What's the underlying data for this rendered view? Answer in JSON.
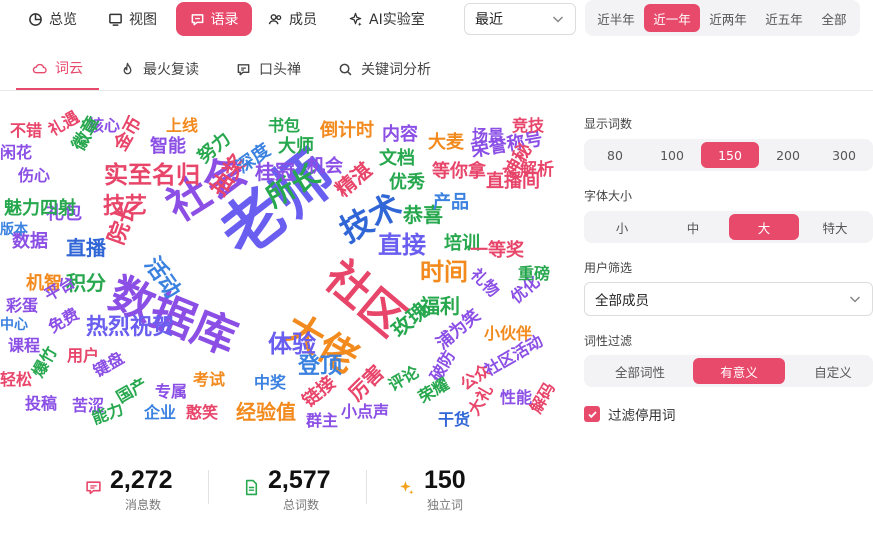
{
  "nav": {
    "items": [
      {
        "label": "总览",
        "icon": "pie-chart-icon"
      },
      {
        "label": "视图",
        "icon": "monitor-icon"
      },
      {
        "label": "语录",
        "icon": "chat-icon"
      },
      {
        "label": "成员",
        "icon": "users-icon"
      },
      {
        "label": "AI实验室",
        "icon": "sparkle-icon"
      }
    ],
    "active_index": 2
  },
  "period_select": {
    "value": "最近"
  },
  "ranges": {
    "items": [
      "近半年",
      "近一年",
      "近两年",
      "近五年",
      "全部"
    ],
    "active_index": 1
  },
  "subtabs": {
    "items": [
      {
        "label": "词云",
        "icon": "cloud-icon"
      },
      {
        "label": "最火复读",
        "icon": "fire-icon"
      },
      {
        "label": "口头禅",
        "icon": "message-icon"
      },
      {
        "label": "关键词分析",
        "icon": "search-icon"
      }
    ],
    "active_index": 0
  },
  "word_cloud": {
    "words": [
      {
        "text": "老师",
        "color": "#6a5ef0"
      },
      {
        "text": "数据库",
        "color": "#8b4fe6"
      },
      {
        "text": "社区",
        "color": "#e8456a"
      },
      {
        "text": "大佬",
        "color": "#f28a1e"
      },
      {
        "text": "社会",
        "color": "#8b4fe6"
      },
      {
        "text": "技术",
        "color": "#3166d6"
      },
      {
        "text": "所长",
        "color": "#27a84e"
      },
      {
        "text": "直接",
        "color": "#6a5ef0"
      },
      {
        "text": "时间",
        "color": "#f28a1e"
      },
      {
        "text": "活动",
        "color": "#3b82e0"
      },
      {
        "text": "实至名归",
        "color": "#e8456a"
      },
      {
        "text": "热烈祝贺",
        "color": "#6a5ef0"
      },
      {
        "text": "体验",
        "color": "#6a5ef0"
      },
      {
        "text": "登顶",
        "color": "#3b82e0"
      },
      {
        "text": "技艺",
        "color": "#e8456a"
      },
      {
        "text": "院长",
        "color": "#e8456a"
      },
      {
        "text": "抽奖",
        "color": "#e8456a"
      },
      {
        "text": "桂冠",
        "color": "#8b4fe6"
      },
      {
        "text": "精湛",
        "color": "#e8456a"
      },
      {
        "text": "恭喜",
        "color": "#27a84e"
      },
      {
        "text": "积分",
        "color": "#27a84e"
      },
      {
        "text": "直播",
        "color": "#3166d6"
      },
      {
        "text": "厉害",
        "color": "#e8456a"
      },
      {
        "text": "玫瑰",
        "color": "#27a84e"
      },
      {
        "text": "福利",
        "color": "#27a84e"
      },
      {
        "text": "经验值",
        "color": "#f28a1e"
      },
      {
        "text": "链接",
        "color": "#e8456a"
      },
      {
        "text": "机会",
        "color": "#8b4fe6"
      },
      {
        "text": "大师",
        "color": "#27a84e"
      },
      {
        "text": "文档",
        "color": "#27a84e"
      },
      {
        "text": "优秀",
        "color": "#27a84e"
      },
      {
        "text": "培训",
        "color": "#27a84e"
      },
      {
        "text": "产品",
        "color": "#3b82e0"
      },
      {
        "text": "一等奖",
        "color": "#e8456a"
      },
      {
        "text": "机智",
        "color": "#f28a1e"
      },
      {
        "text": "数据",
        "color": "#8b4fe6"
      },
      {
        "text": "礼包",
        "color": "#8b4fe6"
      },
      {
        "text": "魅力四射",
        "color": "#27a84e"
      },
      {
        "text": "倒计时",
        "color": "#f28a1e"
      },
      {
        "text": "内容",
        "color": "#8b4fe6"
      },
      {
        "text": "大麦",
        "color": "#f28a1e"
      },
      {
        "text": "等你拿",
        "color": "#e8456a"
      },
      {
        "text": "荣誉称号",
        "color": "#8b4fe6"
      },
      {
        "text": "直播间",
        "color": "#e8456a"
      },
      {
        "text": "神秘",
        "color": "#e8456a"
      },
      {
        "text": "解析",
        "color": "#e8456a"
      },
      {
        "text": "场景",
        "color": "#8b4fe6"
      },
      {
        "text": "竞技",
        "color": "#e8456a"
      },
      {
        "text": "深度",
        "color": "#3b82e0"
      },
      {
        "text": "书包",
        "color": "#27a84e"
      },
      {
        "text": "努力",
        "color": "#27a84e"
      },
      {
        "text": "智能",
        "color": "#8b4fe6"
      },
      {
        "text": "上线",
        "color": "#f28a1e"
      },
      {
        "text": "核心",
        "color": "#8b4fe6"
      },
      {
        "text": "金币",
        "color": "#e8456a"
      },
      {
        "text": "徽章",
        "color": "#27a84e"
      },
      {
        "text": "礼遇",
        "color": "#e8456a"
      },
      {
        "text": "不错",
        "color": "#e8456a"
      },
      {
        "text": "闲花",
        "color": "#8b4fe6"
      },
      {
        "text": "伤心",
        "color": "#8b4fe6"
      },
      {
        "text": "版本",
        "color": "#3b82e0"
      },
      {
        "text": "彩蛋",
        "color": "#8b4fe6"
      },
      {
        "text": "平台",
        "color": "#8b4fe6"
      },
      {
        "text": "中心",
        "color": "#3b82e0"
      },
      {
        "text": "课程",
        "color": "#8b4fe6"
      },
      {
        "text": "免费",
        "color": "#8b4fe6"
      },
      {
        "text": "用户",
        "color": "#e8456a"
      },
      {
        "text": "轻松",
        "color": "#e8456a"
      },
      {
        "text": "爆竹",
        "color": "#27a84e"
      },
      {
        "text": "键盘",
        "color": "#8b4fe6"
      },
      {
        "text": "投稿",
        "color": "#8b4fe6"
      },
      {
        "text": "苦涩",
        "color": "#8b4fe6"
      },
      {
        "text": "国产",
        "color": "#27a84e"
      },
      {
        "text": "专属",
        "color": "#8b4fe6"
      },
      {
        "text": "考试",
        "color": "#f28a1e"
      },
      {
        "text": "能力",
        "color": "#27a84e"
      },
      {
        "text": "企业",
        "color": "#3b82e0"
      },
      {
        "text": "憨笑",
        "color": "#e8456a"
      },
      {
        "text": "中奖",
        "color": "#3b82e0"
      },
      {
        "text": "群主",
        "color": "#8b4fe6"
      },
      {
        "text": "小点声",
        "color": "#8b4fe6"
      },
      {
        "text": "评论",
        "color": "#27a84e"
      },
      {
        "text": "破防",
        "color": "#8b4fe6"
      },
      {
        "text": "荣耀",
        "color": "#27a84e"
      },
      {
        "text": "浦为笑",
        "color": "#8b4fe6"
      },
      {
        "text": "公众",
        "color": "#e8456a"
      },
      {
        "text": "大礼",
        "color": "#e8456a"
      },
      {
        "text": "干货",
        "color": "#3166d6"
      },
      {
        "text": "小伙伴",
        "color": "#f28a1e"
      },
      {
        "text": "社区活动",
        "color": "#8b4fe6"
      },
      {
        "text": "性能",
        "color": "#8b4fe6"
      },
      {
        "text": "解码",
        "color": "#e8456a"
      },
      {
        "text": "优化",
        "color": "#8b4fe6"
      },
      {
        "text": "重磅",
        "color": "#27a84e"
      },
      {
        "text": "礼物",
        "color": "#8b4fe6"
      }
    ]
  },
  "stats": [
    {
      "value": "2,272",
      "label": "消息数",
      "icon": "message-icon",
      "color": "#e8456a"
    },
    {
      "value": "2,577",
      "label": "总词数",
      "icon": "document-icon",
      "color": "#27a84e"
    },
    {
      "value": "150",
      "label": "独立词",
      "icon": "sparkle-icon",
      "color": "#f2a21e"
    }
  ],
  "settings": {
    "word_count": {
      "label": "显示词数",
      "options": [
        "80",
        "100",
        "150",
        "200",
        "300"
      ],
      "active_index": 2
    },
    "font_size": {
      "label": "字体大小",
      "options": [
        "小",
        "中",
        "大",
        "特大"
      ],
      "active_index": 2
    },
    "user_filter": {
      "label": "用户筛选",
      "value": "全部成员"
    },
    "pos_filter": {
      "label": "词性过滤",
      "options": [
        "全部词性",
        "有意义",
        "自定义"
      ],
      "active_index": 1
    },
    "stopwords": {
      "label": "过滤停用词",
      "checked": true
    }
  },
  "accent_color": "#e84a6c"
}
